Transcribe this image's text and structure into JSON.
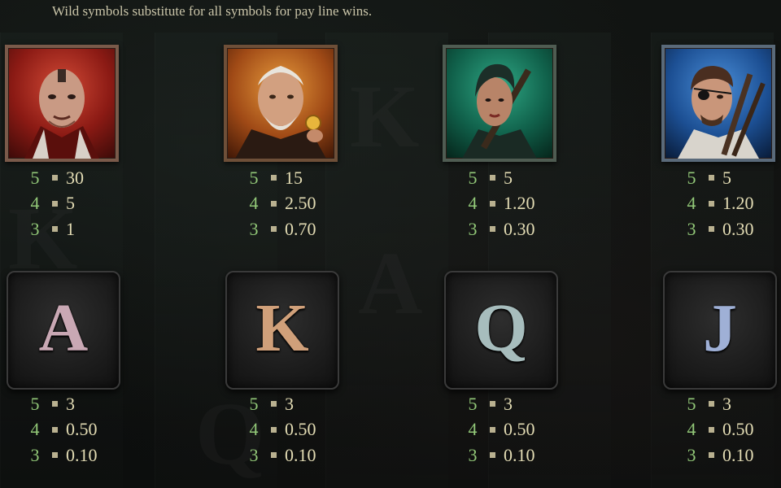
{
  "intro_text": "Wild symbols substitute for all symbols for pay line wins.",
  "background_letters": [
    "A",
    "K",
    "Q",
    "A",
    "K"
  ],
  "portrait_symbols": [
    {
      "name": "bald-man",
      "theme": "red",
      "pays": [
        {
          "count": "5",
          "value": "30"
        },
        {
          "count": "4",
          "value": "5"
        },
        {
          "count": "3",
          "value": "1"
        }
      ]
    },
    {
      "name": "old-man-coin",
      "theme": "amber",
      "pays": [
        {
          "count": "5",
          "value": "15"
        },
        {
          "count": "4",
          "value": "2.50"
        },
        {
          "count": "3",
          "value": "0.70"
        }
      ]
    },
    {
      "name": "woman-rifle",
      "theme": "green",
      "pays": [
        {
          "count": "5",
          "value": "5"
        },
        {
          "count": "4",
          "value": "1.20"
        },
        {
          "count": "3",
          "value": "0.30"
        }
      ]
    },
    {
      "name": "eyepatch-man",
      "theme": "blue",
      "pays": [
        {
          "count": "5",
          "value": "5"
        },
        {
          "count": "4",
          "value": "1.20"
        },
        {
          "count": "3",
          "value": "0.30"
        }
      ]
    }
  ],
  "letter_symbols": [
    {
      "letter": "A",
      "color": "#c9a8b4",
      "pays": [
        {
          "count": "5",
          "value": "3"
        },
        {
          "count": "4",
          "value": "0.50"
        },
        {
          "count": "3",
          "value": "0.10"
        }
      ]
    },
    {
      "letter": "K",
      "color": "#d0a07a",
      "pays": [
        {
          "count": "5",
          "value": "3"
        },
        {
          "count": "4",
          "value": "0.50"
        },
        {
          "count": "3",
          "value": "0.10"
        }
      ]
    },
    {
      "letter": "Q",
      "color": "#a7bdbd",
      "pays": [
        {
          "count": "5",
          "value": "3"
        },
        {
          "count": "4",
          "value": "0.50"
        },
        {
          "count": "3",
          "value": "0.10"
        }
      ]
    },
    {
      "letter": "J",
      "color": "#9fb0d6",
      "pays": [
        {
          "count": "5",
          "value": "3"
        },
        {
          "count": "4",
          "value": "0.50"
        },
        {
          "count": "3",
          "value": "0.10"
        }
      ]
    }
  ]
}
